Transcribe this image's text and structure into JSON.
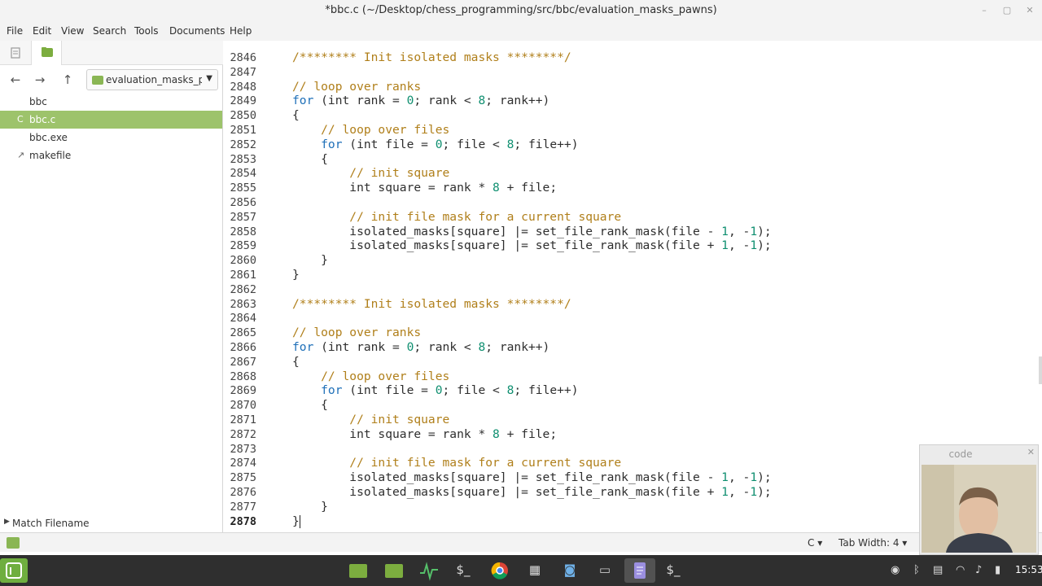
{
  "window": {
    "title": "*bbc.c (~/Desktop/chess_programming/src/bbc/evaluation_masks_pawns)",
    "minimize_glyph": "–",
    "maximize_glyph": "▢",
    "close_glyph": "✕"
  },
  "menu": [
    "File",
    "Edit",
    "View",
    "Search",
    "Tools",
    "Documents",
    "Help"
  ],
  "sidebar": {
    "location": "evaluation_masks_p...",
    "files": [
      {
        "name": "bbc",
        "icon": "",
        "selected": false
      },
      {
        "name": "bbc.c",
        "icon": "C",
        "selected": true
      },
      {
        "name": "bbc.exe",
        "icon": "",
        "selected": false
      },
      {
        "name": "makefile",
        "icon": "↗",
        "selected": false
      }
    ],
    "match_filename": "Match Filename"
  },
  "editor": {
    "lines": [
      {
        "n": "2846",
        "code": [
          {
            "t": "comment",
            "v": "/******** Init isolated masks ********/"
          }
        ]
      },
      {
        "n": "2847",
        "code": []
      },
      {
        "n": "2848",
        "code": [
          {
            "t": "comment",
            "v": "// loop over ranks"
          }
        ]
      },
      {
        "n": "2849",
        "code": [
          {
            "t": "keyword",
            "v": "for"
          },
          {
            "t": "plain",
            "v": " (int rank = "
          },
          {
            "t": "number",
            "v": "0"
          },
          {
            "t": "plain",
            "v": "; rank < "
          },
          {
            "t": "number",
            "v": "8"
          },
          {
            "t": "plain",
            "v": "; rank++)"
          }
        ]
      },
      {
        "n": "2850",
        "code": [
          {
            "t": "plain",
            "v": "{"
          }
        ]
      },
      {
        "n": "2851",
        "code": [
          {
            "t": "comment",
            "v": "    // loop over files"
          }
        ]
      },
      {
        "n": "2852",
        "code": [
          {
            "t": "keyword",
            "v": "    for"
          },
          {
            "t": "plain",
            "v": " (int file = "
          },
          {
            "t": "number",
            "v": "0"
          },
          {
            "t": "plain",
            "v": "; file < "
          },
          {
            "t": "number",
            "v": "8"
          },
          {
            "t": "plain",
            "v": "; file++)"
          }
        ]
      },
      {
        "n": "2853",
        "code": [
          {
            "t": "plain",
            "v": "    {"
          }
        ]
      },
      {
        "n": "2854",
        "code": [
          {
            "t": "comment",
            "v": "        // init square"
          }
        ]
      },
      {
        "n": "2855",
        "code": [
          {
            "t": "plain",
            "v": "        int square = rank * "
          },
          {
            "t": "number",
            "v": "8"
          },
          {
            "t": "plain",
            "v": " + file;"
          }
        ]
      },
      {
        "n": "2856",
        "code": []
      },
      {
        "n": "2857",
        "code": [
          {
            "t": "comment",
            "v": "        // init file mask for a current square"
          }
        ]
      },
      {
        "n": "2858",
        "code": [
          {
            "t": "plain",
            "v": "        isolated_masks[square] |= set_file_rank_mask(file - "
          },
          {
            "t": "number",
            "v": "1"
          },
          {
            "t": "plain",
            "v": ", -"
          },
          {
            "t": "number",
            "v": "1"
          },
          {
            "t": "plain",
            "v": ");"
          }
        ]
      },
      {
        "n": "2859",
        "code": [
          {
            "t": "plain",
            "v": "        isolated_masks[square] |= set_file_rank_mask(file + "
          },
          {
            "t": "number",
            "v": "1"
          },
          {
            "t": "plain",
            "v": ", -"
          },
          {
            "t": "number",
            "v": "1"
          },
          {
            "t": "plain",
            "v": ");"
          }
        ]
      },
      {
        "n": "2860",
        "code": [
          {
            "t": "plain",
            "v": "    }"
          }
        ]
      },
      {
        "n": "2861",
        "code": [
          {
            "t": "plain",
            "v": "}"
          }
        ]
      },
      {
        "n": "2862",
        "code": []
      },
      {
        "n": "2863",
        "code": [
          {
            "t": "comment",
            "v": "/******** Init isolated masks ********/"
          }
        ]
      },
      {
        "n": "2864",
        "code": []
      },
      {
        "n": "2865",
        "code": [
          {
            "t": "comment",
            "v": "// loop over ranks"
          }
        ]
      },
      {
        "n": "2866",
        "code": [
          {
            "t": "keyword",
            "v": "for"
          },
          {
            "t": "plain",
            "v": " (int rank = "
          },
          {
            "t": "number",
            "v": "0"
          },
          {
            "t": "plain",
            "v": "; rank < "
          },
          {
            "t": "number",
            "v": "8"
          },
          {
            "t": "plain",
            "v": "; rank++)"
          }
        ]
      },
      {
        "n": "2867",
        "code": [
          {
            "t": "plain",
            "v": "{"
          }
        ]
      },
      {
        "n": "2868",
        "code": [
          {
            "t": "comment",
            "v": "    // loop over files"
          }
        ]
      },
      {
        "n": "2869",
        "code": [
          {
            "t": "keyword",
            "v": "    for"
          },
          {
            "t": "plain",
            "v": " (int file = "
          },
          {
            "t": "number",
            "v": "0"
          },
          {
            "t": "plain",
            "v": "; file < "
          },
          {
            "t": "number",
            "v": "8"
          },
          {
            "t": "plain",
            "v": "; file++)"
          }
        ]
      },
      {
        "n": "2870",
        "code": [
          {
            "t": "plain",
            "v": "    {"
          }
        ]
      },
      {
        "n": "2871",
        "code": [
          {
            "t": "comment",
            "v": "        // init square"
          }
        ]
      },
      {
        "n": "2872",
        "code": [
          {
            "t": "plain",
            "v": "        int square = rank * "
          },
          {
            "t": "number",
            "v": "8"
          },
          {
            "t": "plain",
            "v": " + file;"
          }
        ]
      },
      {
        "n": "2873",
        "code": []
      },
      {
        "n": "2874",
        "code": [
          {
            "t": "comment",
            "v": "        // init file mask for a current square"
          }
        ]
      },
      {
        "n": "2875",
        "code": [
          {
            "t": "plain",
            "v": "        isolated_masks[square] |= set_file_rank_mask(file - "
          },
          {
            "t": "number",
            "v": "1"
          },
          {
            "t": "plain",
            "v": ", -"
          },
          {
            "t": "number",
            "v": "1"
          },
          {
            "t": "plain",
            "v": ");"
          }
        ]
      },
      {
        "n": "2876",
        "code": [
          {
            "t": "plain",
            "v": "        isolated_masks[square] |= set_file_rank_mask(file + "
          },
          {
            "t": "number",
            "v": "1"
          },
          {
            "t": "plain",
            "v": ", -"
          },
          {
            "t": "number",
            "v": "1"
          },
          {
            "t": "plain",
            "v": ");"
          }
        ]
      },
      {
        "n": "2877",
        "code": [
          {
            "t": "plain",
            "v": "    }"
          }
        ]
      },
      {
        "n": "2878",
        "code": [
          {
            "t": "plain",
            "v": "}"
          }
        ],
        "current": true
      }
    ]
  },
  "statusbar": {
    "language": "C",
    "tab_width": "Tab Width: 4"
  },
  "webcam": {
    "title": "code"
  },
  "taskbar": {
    "clock": "15:53"
  },
  "colors": {
    "accent": "#9dc36b",
    "comment": "#b07f1a",
    "keyword": "#1e6fb8",
    "number": "#0f8f70"
  }
}
